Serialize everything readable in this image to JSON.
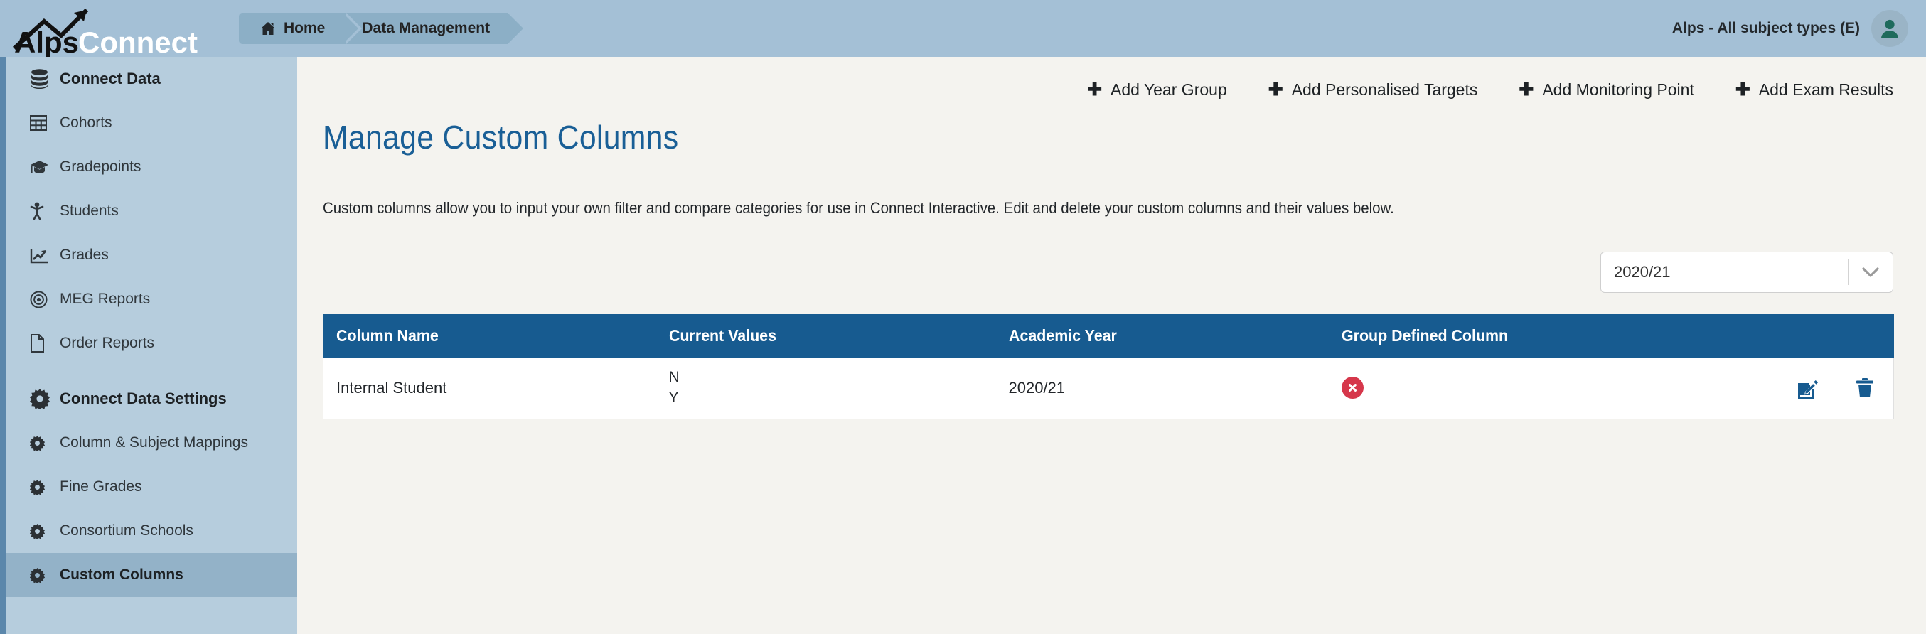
{
  "header": {
    "brand_primary": "Alps",
    "brand_secondary": "Connect",
    "breadcrumbs": [
      {
        "label": "Home",
        "icon": "home-icon"
      },
      {
        "label": "Data Management",
        "icon": ""
      }
    ],
    "account_label": "Alps - All subject types (E)",
    "avatar_icon": "user-avatar-icon",
    "bar_color": "#a4c0d6",
    "crumb_color": "#8cafc6"
  },
  "sidebar": {
    "background_color": "#b6cddd",
    "accent_color": "#5b87ab",
    "active_color": "#93b2c8",
    "groups": [
      {
        "title": "Connect Data",
        "icon": "database-icon",
        "items": [
          {
            "label": "Cohorts",
            "icon": "table-grid-icon",
            "active": false
          },
          {
            "label": "Gradepoints",
            "icon": "graduation-cap-icon",
            "active": false
          },
          {
            "label": "Students",
            "icon": "student-person-icon",
            "active": false
          },
          {
            "label": "Grades",
            "icon": "chart-line-icon",
            "active": false
          },
          {
            "label": "MEG Reports",
            "icon": "target-bullseye-icon",
            "active": false
          },
          {
            "label": "Order Reports",
            "icon": "file-page-icon",
            "active": false
          }
        ]
      },
      {
        "title": "Connect Data Settings",
        "icon": "gear-icon",
        "items": [
          {
            "label": "Column & Subject Mappings",
            "icon": "gear-icon",
            "active": false
          },
          {
            "label": "Fine Grades",
            "icon": "gear-icon",
            "active": false
          },
          {
            "label": "Consortium Schools",
            "icon": "gear-icon",
            "active": false
          },
          {
            "label": "Custom Columns",
            "icon": "gear-icon",
            "active": true
          }
        ]
      }
    ]
  },
  "toolbar": {
    "actions": [
      {
        "label": "Add Year Group",
        "icon": "plus-icon"
      },
      {
        "label": "Add Personalised Targets",
        "icon": "plus-icon"
      },
      {
        "label": "Add Monitoring Point",
        "icon": "plus-icon"
      },
      {
        "label": "Add Exam Results",
        "icon": "plus-icon"
      }
    ]
  },
  "main": {
    "title": "Manage Custom Columns",
    "title_color": "#1a5f96",
    "description": "Custom columns allow you to input your own filter and compare categories for use in Connect Interactive. Edit and delete your custom columns and their values below.",
    "year_select": {
      "value": "2020/21",
      "icon": "chevron-down-icon"
    },
    "table": {
      "header_color": "#175b90",
      "columns": [
        "Column Name",
        "Current Values",
        "Academic Year",
        "Group Defined Column",
        ""
      ],
      "rows": [
        {
          "column_name": "Internal Student",
          "current_values": [
            "N",
            "Y"
          ],
          "academic_year": "2020/21",
          "group_defined_column": false,
          "group_defined_icon": "red-x-circle-icon",
          "group_defined_color": "#d6374b",
          "actions": [
            {
              "name": "edit-row-button",
              "icon": "edit-pencil-square-icon"
            },
            {
              "name": "delete-row-button",
              "icon": "trash-can-icon"
            }
          ]
        }
      ]
    }
  }
}
